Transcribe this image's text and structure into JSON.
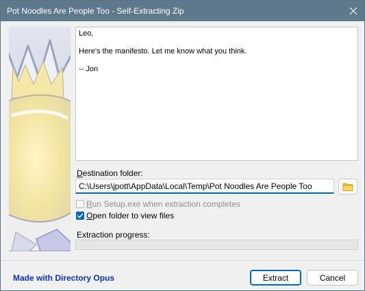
{
  "window": {
    "title": "Pot Noodles Are People Too - Self-Extracting Zip"
  },
  "message": {
    "text": "Leo,\n\nHere's the manifesto. Let me know what you think.\n\n-- Jon"
  },
  "destination": {
    "label_mnemonic": "D",
    "label_rest": "estination folder:",
    "value": "C:\\Users\\jpott\\AppData\\Local\\Temp\\Pot Noodles Are People Too"
  },
  "options": {
    "run_setup": {
      "mnemonic": "R",
      "label_rest": "un Setup.exe when extraction completes",
      "checked": false,
      "enabled": false
    },
    "open_folder": {
      "mnemonic": "O",
      "label_rest": "pen folder to view files",
      "checked": true,
      "enabled": true
    }
  },
  "progress": {
    "label": "Extraction progress:",
    "value": 0
  },
  "footer": {
    "made_with": "Made with Directory Opus",
    "extract_label": "Extract",
    "cancel_label": "Cancel"
  },
  "colors": {
    "titlebar": "#5e788c",
    "accent": "#0067c0",
    "link": "#0c2fbf",
    "folder_icon": "#f2c12e"
  },
  "icons": {
    "close": "close-icon",
    "browse": "folder-icon",
    "checkmark": "checkmark-icon"
  }
}
